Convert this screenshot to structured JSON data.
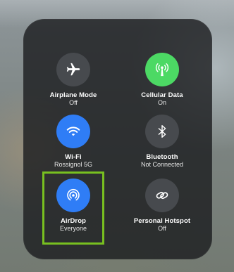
{
  "accent_color": "#78c020",
  "controls": {
    "airplane": {
      "label": "Airplane Mode",
      "status": "Off",
      "icon": "airplane-icon",
      "color": "#474a4e"
    },
    "cellular": {
      "label": "Cellular Data",
      "status": "On",
      "icon": "antenna-icon",
      "color": "#4cd964"
    },
    "wifi": {
      "label": "Wi-Fi",
      "status": "Rossignol 5G",
      "icon": "wifi-icon",
      "color": "#2f7df6"
    },
    "bluetooth": {
      "label": "Bluetooth",
      "status": "Not Connected",
      "icon": "bluetooth-icon",
      "color": "#474a4e"
    },
    "airdrop": {
      "label": "AirDrop",
      "status": "Everyone",
      "icon": "airdrop-icon",
      "color": "#2f7df6"
    },
    "hotspot": {
      "label": "Personal Hotspot",
      "status": "Off",
      "icon": "link-icon",
      "color": "#474a4e"
    }
  }
}
